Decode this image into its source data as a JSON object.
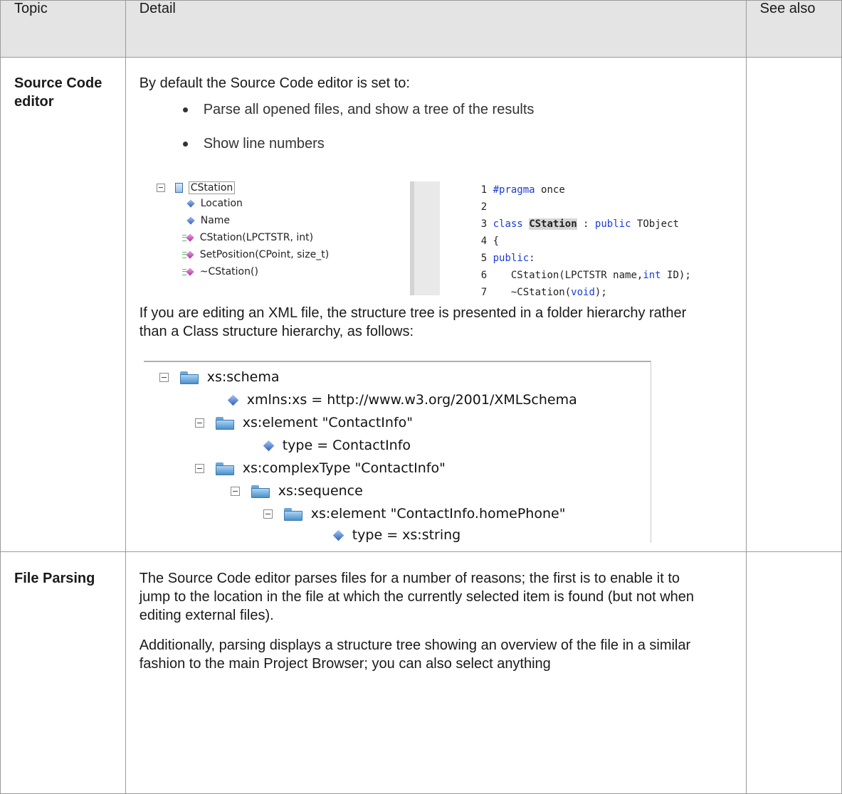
{
  "header": {
    "topic": "Topic",
    "detail": "Detail",
    "see_also": "See also"
  },
  "rows": [
    {
      "topic": "Source Code editor",
      "intro": "By default the Source Code editor is set to:",
      "bullets": [
        "Parse all opened files, and show a tree of the results",
        "Show line numbers"
      ],
      "class_tree": {
        "root": "CStation",
        "items": [
          "Location",
          "Name",
          "CStation(LPCTSTR, int)",
          "SetPosition(CPoint, size_t)",
          "~CStation()"
        ]
      },
      "code": {
        "line1": {
          "num": "1",
          "kw": "#pragma",
          "rest": " once"
        },
        "line2": {
          "num": "2"
        },
        "line3": {
          "num": "3",
          "kw": "class",
          "name": "CStation",
          "mid": " : ",
          "kw2": "public",
          "rest": " TObject"
        },
        "line4": {
          "num": "4",
          "rest": "{"
        },
        "line5": {
          "num": "5",
          "kw": "public",
          "rest": ":"
        },
        "line6": {
          "num": "6",
          "pre": "    CStation(LPCTSTR name,",
          "kw": "int",
          "rest": " ID);"
        },
        "line7": {
          "num": "7",
          "pre": "    ~CStation(",
          "kw": "void",
          "rest": ");"
        }
      },
      "xml_text": "If you are editing an XML file, the structure tree is presented in a folder hierarchy rather than a Class structure hierarchy, as follows:",
      "xml_tree": [
        "xs:schema",
        "xmlns:xs = http://www.w3.org/2001/XMLSchema",
        "xs:element \"ContactInfo\"",
        "type = ContactInfo",
        "xs:complexType \"ContactInfo\"",
        "xs:sequence",
        "xs:element \"ContactInfo.homePhone\"",
        "type = xs:string"
      ]
    },
    {
      "topic": "File Parsing",
      "para1": "The Source Code editor parses files for a number of reasons; the first is to enable it to jump to the location in the file at which the currently selected item is found (but not when editing external files).",
      "para2": "Additionally, parsing displays a structure tree showing an overview of the file in a similar fashion to the main Project Browser; you can also select anything"
    }
  ]
}
